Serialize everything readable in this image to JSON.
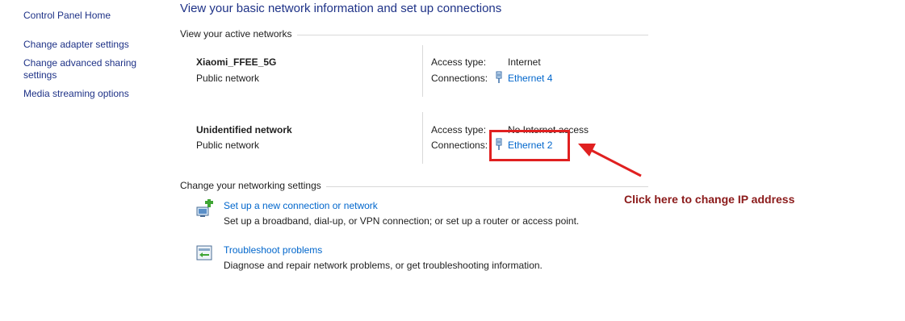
{
  "sidebar": {
    "home": "Control Panel Home",
    "items": [
      {
        "label": "Change adapter settings"
      },
      {
        "label_line1": "Change advanced sharing",
        "label_line2": "settings"
      },
      {
        "label": "Media streaming options"
      }
    ]
  },
  "main": {
    "title": "View your basic network information and set up connections",
    "active_networks_heading": "View your active networks",
    "networks": [
      {
        "name": "Xiaomi_FFEE_5G",
        "category": "Public network",
        "access_type_label": "Access type:",
        "access_type_value": "Internet",
        "connections_label": "Connections:",
        "connection_link": "Ethernet 4"
      },
      {
        "name": "Unidentified network",
        "category": "Public network",
        "access_type_label": "Access type:",
        "access_type_value": "No Internet access",
        "connections_label": "Connections:",
        "connection_link": "Ethernet 2"
      }
    ],
    "change_settings_heading": "Change your networking settings",
    "tasks": [
      {
        "link": "Set up a new connection or network",
        "description": "Set up a broadband, dial-up, or VPN connection; or set up a router or access point.",
        "icon": "new-connection-icon"
      },
      {
        "link": "Troubleshoot problems",
        "description": "Diagnose and repair network problems, or get troubleshooting information.",
        "icon": "troubleshoot-icon"
      }
    ]
  },
  "annotation": {
    "text": "Click here to change IP address",
    "color": "#e02020"
  }
}
